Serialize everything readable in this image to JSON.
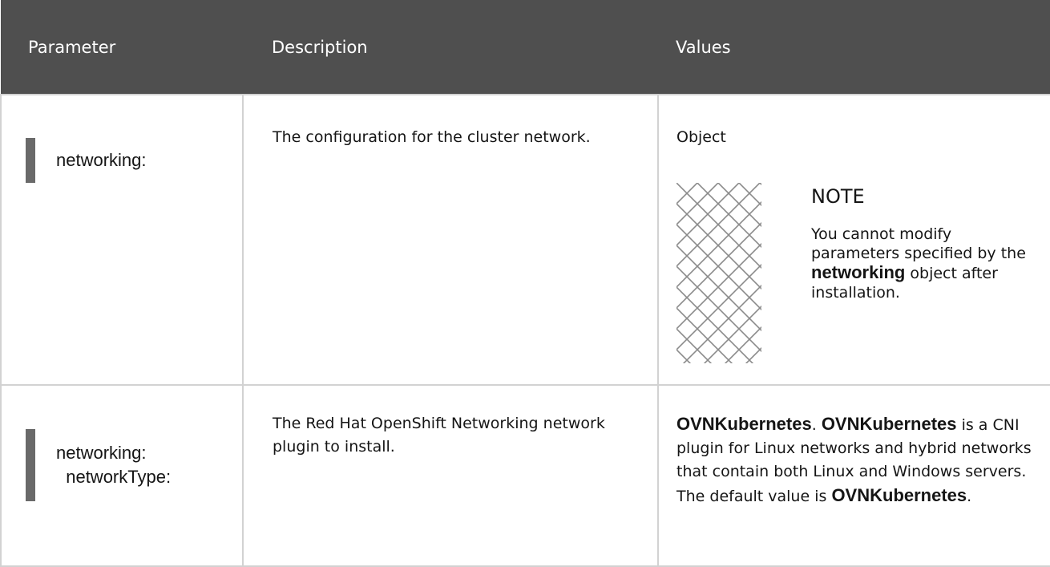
{
  "headers": {
    "parameter": "Parameter",
    "description": "Description",
    "values": "Values"
  },
  "rows": [
    {
      "parameter": "networking:",
      "description": "The configuration for the cluster network.",
      "value": "Object",
      "note": {
        "title": "NOTE",
        "text_before": "You cannot modify parameters specified by the ",
        "code": "networking",
        "text_after": " object after installation."
      }
    },
    {
      "parameter": "networking:\n  networkType:",
      "description": "The Red Hat OpenShift Networking network plugin to install.",
      "value": {
        "code1": "OVNKubernetes",
        "sep": ". ",
        "code2": "OVNKubernetes",
        "text": " is a CNI plugin for Linux networks and hybrid networks that contain both Linux and Windows servers. The default value is ",
        "code3": "OVNKubernetes",
        "end": "."
      }
    }
  ],
  "colors": {
    "header_bg": "#4f4f4f",
    "border": "#d2d2d2",
    "code_bar": "#6a6a6a"
  },
  "icons": {
    "note_pattern": "crosshatch-pattern-icon"
  }
}
